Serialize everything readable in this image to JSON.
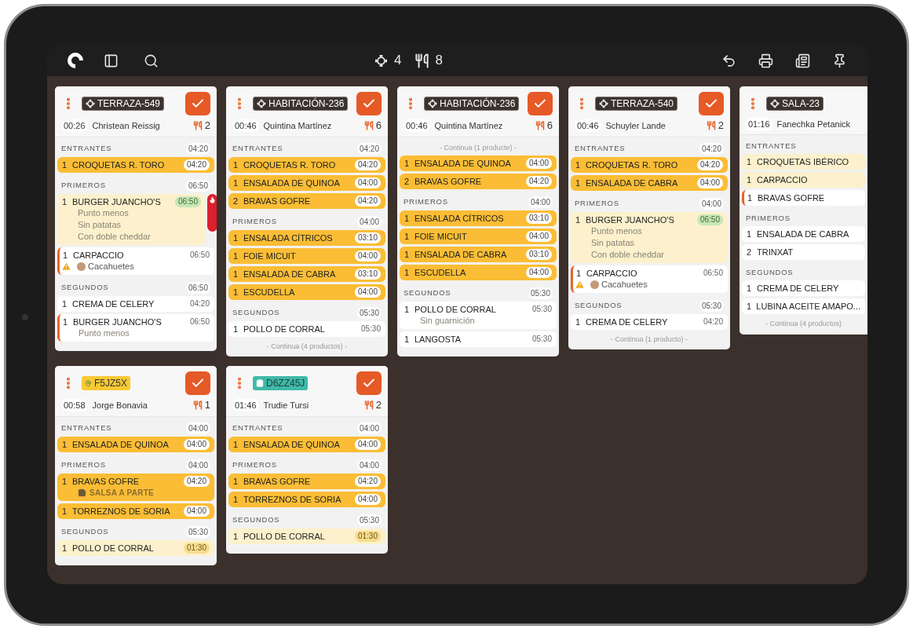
{
  "toolbar": {
    "tables_count": "4",
    "covers_count": "8"
  },
  "rows": [
    {
      "cards": [
        {
          "tag": {
            "kind": "table",
            "label": "TERRAZA-549"
          },
          "done_button": true,
          "elapsed": "00:26",
          "customer": "Christean Reissig",
          "guests": "2",
          "sections": [
            {
              "label": "ENTRANTES",
              "time": "04:20",
              "items": [
                {
                  "qty": "1",
                  "name": "CROQUETAS R. TORO",
                  "time": "04:20",
                  "kind": "cooking",
                  "flagged": false,
                  "alarm": false
                }
              ]
            },
            {
              "label": "PRIMEROS",
              "time": "06:50",
              "items": [
                {
                  "qty": "1",
                  "name": "BURGER JUANCHO'S",
                  "time": "06:50",
                  "kind": "pending",
                  "flagged": false,
                  "time_ok": true,
                  "alarm": true,
                  "notes": [
                    {
                      "kind": "modifier",
                      "text": "Punto menos"
                    },
                    {
                      "kind": "modifier",
                      "text": "Sin patatas"
                    },
                    {
                      "kind": "modifier",
                      "text": "Con doble cheddar"
                    }
                  ]
                },
                {
                  "qty": "1",
                  "name": "CARPACCIO",
                  "time": "06:50",
                  "kind": "idle",
                  "flagged": true,
                  "alarm": false,
                  "notes": [
                    {
                      "kind": "allergen",
                      "text": "Cacahuetes"
                    }
                  ]
                }
              ]
            },
            {
              "label": "SEGUNDOS",
              "time": "06:50",
              "items": [
                {
                  "qty": "1",
                  "name": "CREMA DE CELERY",
                  "time": "04:20",
                  "kind": "idle",
                  "flagged": false,
                  "alarm": false
                },
                {
                  "qty": "1",
                  "name": "BURGER JUANCHO'S",
                  "time": "06:50",
                  "kind": "idle",
                  "flagged": true,
                  "alarm": false,
                  "notes": [
                    {
                      "kind": "modifier",
                      "text": "Punto menos"
                    }
                  ]
                }
              ]
            }
          ]
        },
        {
          "tag": {
            "kind": "table",
            "label": "HABITACIÓN-236"
          },
          "done_button": true,
          "elapsed": "00:46",
          "customer": "Quintina Martínez",
          "guests": "6",
          "continued_below": "- Continua (4 productos) -",
          "sections": [
            {
              "label": "ENTRANTES",
              "time": "04:20",
              "items": [
                {
                  "qty": "1",
                  "name": "CROQUETAS R. TORO",
                  "time": "04:20",
                  "kind": "cooking",
                  "flagged": false,
                  "alarm": false
                },
                {
                  "qty": "1",
                  "name": "ENSALADA DE QUINOA",
                  "time": "04:00",
                  "kind": "cooking",
                  "flagged": false,
                  "alarm": false
                },
                {
                  "qty": "2",
                  "name": "BRAVAS GOFRE",
                  "time": "04:20",
                  "kind": "cooking",
                  "flagged": false,
                  "alarm": false
                }
              ]
            },
            {
              "label": "PRIMEROS",
              "time": "04:00",
              "items": [
                {
                  "qty": "1",
                  "name": "ENSALADA CÍTRICOS",
                  "time": "03:10",
                  "kind": "cooking",
                  "flagged": false,
                  "alarm": false
                },
                {
                  "qty": "1",
                  "name": "FOIE MICUIT",
                  "time": "04:00",
                  "kind": "cooking",
                  "flagged": false,
                  "alarm": false
                },
                {
                  "qty": "1",
                  "name": "ENSALADA DE CABRA",
                  "time": "03:10",
                  "kind": "cooking",
                  "flagged": false,
                  "alarm": false
                },
                {
                  "qty": "1",
                  "name": "ESCUDELLA",
                  "time": "04:00",
                  "kind": "cooking",
                  "flagged": false,
                  "alarm": false
                }
              ]
            },
            {
              "label": "SEGUNDOS",
              "time": "05:30",
              "items": [
                {
                  "qty": "1",
                  "name": "POLLO DE CORRAL",
                  "time": "05:30",
                  "kind": "idle",
                  "flagged": false,
                  "alarm": false
                }
              ]
            }
          ]
        },
        {
          "tag": {
            "kind": "table",
            "label": "HABITACIÓN-236"
          },
          "done_button": true,
          "elapsed": "00:46",
          "customer": "Quintina Martínez",
          "guests": "6",
          "continued_above": "- Continua (1 producte) -",
          "sections": [
            {
              "items": [
                {
                  "qty": "1",
                  "name": "ENSALADA DE QUINOA",
                  "time": "04:00",
                  "kind": "cooking",
                  "flagged": false,
                  "alarm": false
                },
                {
                  "qty": "2",
                  "name": "BRAVAS GOFRE",
                  "time": "04:20",
                  "kind": "cooking",
                  "flagged": false,
                  "alarm": false
                }
              ]
            },
            {
              "label": "PRIMEROS",
              "time": "04:00",
              "items": [
                {
                  "qty": "1",
                  "name": "ENSALADA CÍTRICOS",
                  "time": "03:10",
                  "kind": "cooking",
                  "flagged": false,
                  "alarm": false
                },
                {
                  "qty": "1",
                  "name": "FOIE MICUIT",
                  "time": "04:00",
                  "kind": "cooking",
                  "flagged": false,
                  "alarm": false
                },
                {
                  "qty": "1",
                  "name": "ENSALADA DE CABRA",
                  "time": "03:10",
                  "kind": "cooking",
                  "flagged": false,
                  "alarm": false
                },
                {
                  "qty": "1",
                  "name": "ESCUDELLA",
                  "time": "04:00",
                  "kind": "cooking",
                  "flagged": false,
                  "alarm": false
                }
              ]
            },
            {
              "label": "SEGUNDOS",
              "time": "05:30",
              "items": [
                {
                  "qty": "1",
                  "name": "POLLO DE CORRAL",
                  "time": "05:30",
                  "kind": "idle",
                  "flagged": false,
                  "alarm": false,
                  "notes": [
                    {
                      "kind": "modifier",
                      "text": "Sin guarnición"
                    }
                  ]
                },
                {
                  "qty": "1",
                  "name": "LANGOSTA",
                  "time": "05:30",
                  "kind": "idle",
                  "flagged": false,
                  "alarm": false
                }
              ]
            }
          ]
        },
        {
          "tag": {
            "kind": "table",
            "label": "TERRAZA-540"
          },
          "done_button": true,
          "elapsed": "00:46",
          "customer": "Schuyler Lande",
          "guests": "2",
          "continued_below": "- Continua (1 producto) -",
          "sections": [
            {
              "label": "ENTRANTES",
              "time": "04:20",
              "items": [
                {
                  "qty": "1",
                  "name": "CROQUETAS R. TORO",
                  "time": "04:20",
                  "kind": "cooking",
                  "flagged": false,
                  "alarm": false
                },
                {
                  "qty": "1",
                  "name": "ENSALADA DE CABRA",
                  "time": "04:00",
                  "kind": "cooking",
                  "flagged": false,
                  "alarm": false
                }
              ]
            },
            {
              "label": "PRIMEROS",
              "time": "04:00",
              "items": [
                {
                  "qty": "1",
                  "name": "BURGER JUANCHO'S",
                  "time": "06:50",
                  "kind": "pending",
                  "flagged": false,
                  "time_ok": true,
                  "alarm": false,
                  "notes": [
                    {
                      "kind": "modifier",
                      "text": "Punto menos"
                    },
                    {
                      "kind": "modifier",
                      "text": "Sin patatas"
                    },
                    {
                      "kind": "modifier",
                      "text": "Con doble cheddar"
                    }
                  ]
                },
                {
                  "qty": "1",
                  "name": "CARPACCIO",
                  "time": "06:50",
                  "kind": "idle",
                  "flagged": true,
                  "alarm": false,
                  "notes": [
                    {
                      "kind": "allergen",
                      "text": "Cacahuetes"
                    }
                  ]
                }
              ]
            },
            {
              "label": "SEGUNDOS",
              "time": "05:30",
              "items": [
                {
                  "qty": "1",
                  "name": "CREMA DE CELERY",
                  "time": "04:20",
                  "kind": "idle",
                  "flagged": false,
                  "alarm": false
                }
              ]
            }
          ]
        },
        {
          "tag": {
            "kind": "table",
            "label": "SALA-23"
          },
          "done_button": false,
          "elapsed": "01:16",
          "customer": "Fanechka Petanick",
          "continued_below": "- Continua (4 productos)",
          "sections": [
            {
              "label": "ENTRANTES",
              "items": [
                {
                  "qty": "1",
                  "name": "CROQUETAS IBÉRICO",
                  "kind": "pending",
                  "flagged": false,
                  "alarm": false
                },
                {
                  "qty": "1",
                  "name": "CARPACCIO",
                  "kind": "pending",
                  "flagged": false,
                  "alarm": false
                },
                {
                  "qty": "1",
                  "name": "BRAVAS GOFRE",
                  "kind": "idle",
                  "flagged": true,
                  "alarm": false
                }
              ]
            },
            {
              "label": "PRIMEROS",
              "items": [
                {
                  "qty": "1",
                  "name": "ENSALADA DE CABRA",
                  "kind": "idle",
                  "flagged": false,
                  "alarm": false
                },
                {
                  "qty": "2",
                  "name": "TRINXAT",
                  "kind": "idle",
                  "flagged": false,
                  "alarm": false
                }
              ]
            },
            {
              "label": "SEGUNDOS",
              "items": [
                {
                  "qty": "1",
                  "name": "CREMA DE CELERY",
                  "kind": "idle",
                  "flagged": false,
                  "alarm": false
                },
                {
                  "qty": "1",
                  "name": "LUBINA ACEITE AMAPO...",
                  "kind": "idle",
                  "flagged": false,
                  "alarm": false
                }
              ]
            }
          ]
        }
      ]
    },
    {
      "cards": [
        {
          "tag": {
            "kind": "pickup",
            "label": "F5JZ5X"
          },
          "done_button": true,
          "elapsed": "00:58",
          "customer": "Jorge Bonavia",
          "guests": "1",
          "sections": [
            {
              "label": "ENTRANTES",
              "time": "04:00",
              "items": [
                {
                  "qty": "1",
                  "name": "ENSALADA DE QUINOA",
                  "time": "04:00",
                  "kind": "cooking",
                  "flagged": false,
                  "alarm": false
                }
              ]
            },
            {
              "label": "PRIMEROS",
              "time": "04:00",
              "items": [
                {
                  "qty": "1",
                  "name": "BRAVAS GOFRE",
                  "time": "04:20",
                  "kind": "cooking",
                  "flagged": false,
                  "alarm": false,
                  "notes": [
                    {
                      "kind": "comment",
                      "text": "SALSA A PARTE"
                    }
                  ]
                },
                {
                  "qty": "1",
                  "name": "TORREZNOS DE SORIA",
                  "time": "04:00",
                  "kind": "cooking",
                  "flagged": false,
                  "alarm": false
                }
              ]
            },
            {
              "label": "SEGUNDOS",
              "time": "05:30",
              "items": [
                {
                  "qty": "1",
                  "name": "POLLO DE CORRAL",
                  "time": "01:30",
                  "kind": "pending",
                  "flagged": false,
                  "time_ok": false,
                  "alarm": false
                }
              ]
            }
          ]
        },
        {
          "tag": {
            "kind": "delivery",
            "label": "D6ZZ45J"
          },
          "done_button": true,
          "elapsed": "01:46",
          "customer": "Trudie Tursi",
          "guests": "2",
          "sections": [
            {
              "label": "ENTRANTES",
              "time": "04:00",
              "items": [
                {
                  "qty": "1",
                  "name": "ENSALADA DE QUINOA",
                  "time": "04:00",
                  "kind": "cooking",
                  "flagged": false,
                  "alarm": false
                }
              ]
            },
            {
              "label": "PRIMEROS",
              "time": "04:00",
              "items": [
                {
                  "qty": "1",
                  "name": "BRAVAS GOFRE",
                  "time": "04:20",
                  "kind": "cooking",
                  "flagged": false,
                  "alarm": false
                },
                {
                  "qty": "1",
                  "name": "TORREZNOS DE SORIA",
                  "time": "04:00",
                  "kind": "cooking",
                  "flagged": false,
                  "alarm": false
                }
              ]
            },
            {
              "label": "SEGUNDOS",
              "time": "05:30",
              "items": [
                {
                  "qty": "1",
                  "name": "POLLO DE CORRAL",
                  "time": "01:30",
                  "kind": "pending",
                  "flagged": false,
                  "time_ok": false,
                  "alarm": false
                }
              ]
            }
          ]
        }
      ]
    }
  ]
}
